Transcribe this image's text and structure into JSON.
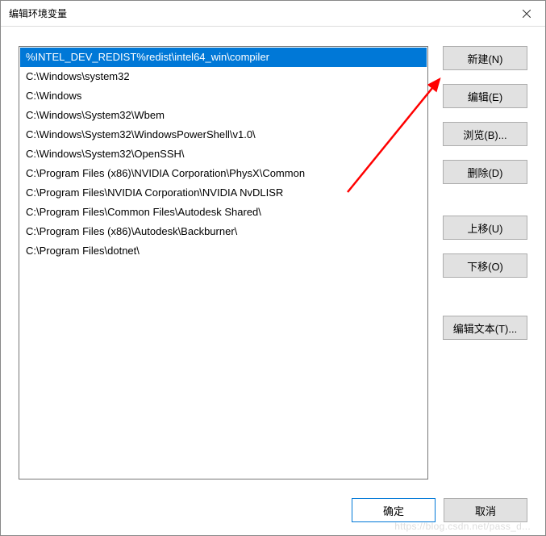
{
  "dialog": {
    "title": "编辑环境变量"
  },
  "list": {
    "items": [
      "%INTEL_DEV_REDIST%redist\\intel64_win\\compiler",
      "C:\\Windows\\system32",
      "C:\\Windows",
      "C:\\Windows\\System32\\Wbem",
      "C:\\Windows\\System32\\WindowsPowerShell\\v1.0\\",
      "C:\\Windows\\System32\\OpenSSH\\",
      "C:\\Program Files (x86)\\NVIDIA Corporation\\PhysX\\Common",
      "C:\\Program Files\\NVIDIA Corporation\\NVIDIA NvDLISR",
      "C:\\Program Files\\Common Files\\Autodesk Shared\\",
      "C:\\Program Files (x86)\\Autodesk\\Backburner\\",
      "C:\\Program Files\\dotnet\\"
    ],
    "selected_index": 0
  },
  "buttons": {
    "new": "新建(N)",
    "edit": "编辑(E)",
    "browse": "浏览(B)...",
    "delete": "删除(D)",
    "move_up": "上移(U)",
    "move_down": "下移(O)",
    "edit_text": "编辑文本(T)...",
    "ok": "确定",
    "cancel": "取消"
  },
  "watermark": "https://blog.csdn.net/pass_d..."
}
